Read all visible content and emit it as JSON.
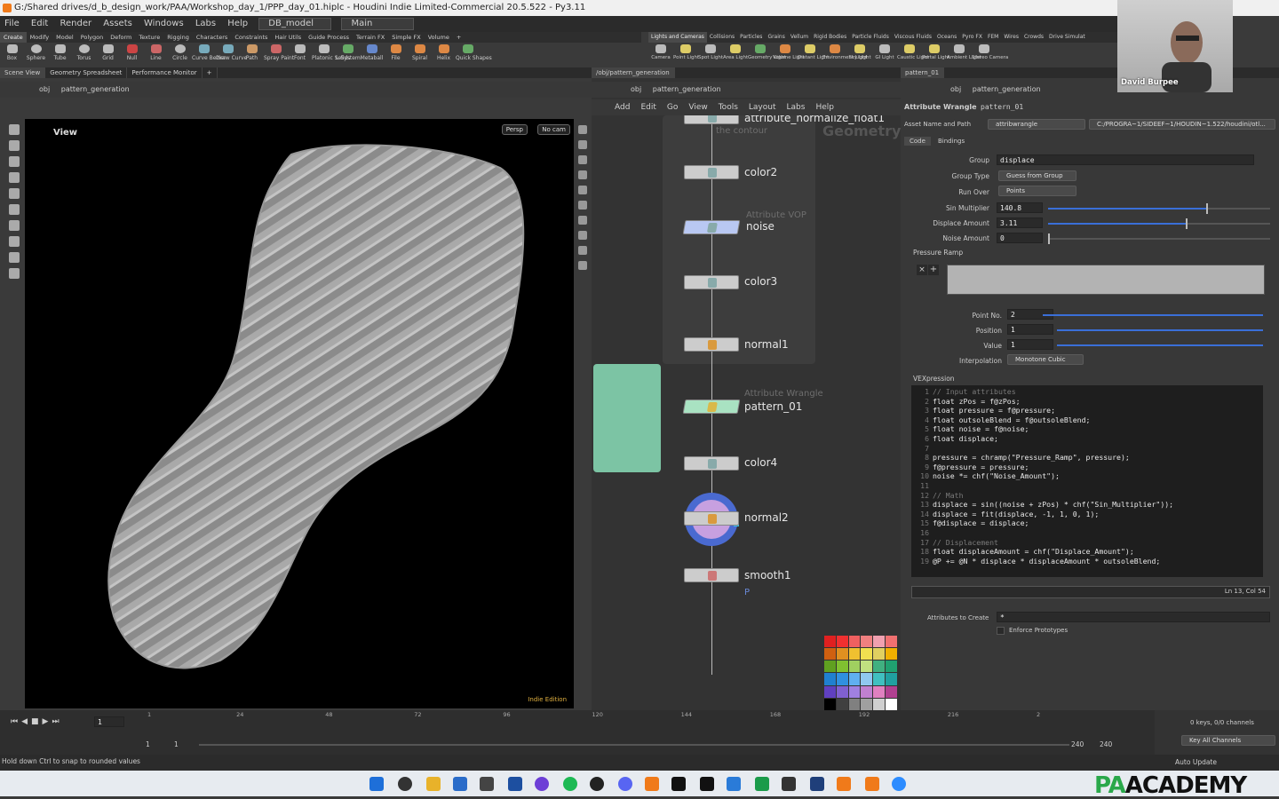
{
  "window": {
    "title": "G:/Shared drives/d_b_design_work/PAA/Workshop_day_1/PPP_day_01.hiplc - Houdini Indie Limited-Commercial 20.5.522 - Py3.11"
  },
  "menu": {
    "items": [
      "File",
      "Edit",
      "Render",
      "Assets",
      "Windows",
      "Labs",
      "Help"
    ],
    "desktop": "DB_model",
    "pane": "Main"
  },
  "shelf_tabs_left": [
    "Create",
    "Modify",
    "Model",
    "Polygon",
    "Deform",
    "Texture",
    "Rigging",
    "Characters",
    "Constraints",
    "Hair Utils",
    "Guide Process",
    "Terrain FX",
    "Simple FX",
    "Volume",
    "+"
  ],
  "shelf_tools_left": [
    "Box",
    "Sphere",
    "Tube",
    "Torus",
    "Grid",
    "Null",
    "Line",
    "Circle",
    "Curve Bezier",
    "Draw Curve",
    "Path",
    "Spray Paint",
    "Font",
    "Platonic Solids",
    "L-System",
    "Metaball",
    "File",
    "Spiral",
    "Helix",
    "Quick Shapes"
  ],
  "shelf_tabs_right": [
    "Lights and Cameras",
    "Collisions",
    "Particles",
    "Grains",
    "Vellum",
    "Rigid Bodies",
    "Particle Fluids",
    "Viscous Fluids",
    "Oceans",
    "Pyro FX",
    "FEM",
    "Wires",
    "Crowds",
    "Drive Simulat"
  ],
  "shelf_tools_right": [
    "Camera",
    "Point Light",
    "Spot Light",
    "Area Light",
    "Geometry Light",
    "Volume Light",
    "Distant Light",
    "Environment Light",
    "Sky Light",
    "GI Light",
    "Caustic Light",
    "Portal Light",
    "Ambient Light",
    "Stereo Camera"
  ],
  "viewer": {
    "tabs": [
      "Scene View",
      "Geometry Spreadsheet",
      "Performance Monitor",
      "+"
    ],
    "path_root": "obj",
    "path_node": "pattern_generation",
    "label": "View",
    "camera_mode": "Persp",
    "camera": "No cam",
    "edition": "Indie Edition"
  },
  "network": {
    "tab": "/obj/pattern_generation",
    "path_root": "obj",
    "path_node": "pattern_generation",
    "menu": [
      "Add",
      "Edit",
      "Go",
      "View",
      "Tools",
      "Layout",
      "Labs",
      "Help"
    ],
    "context_label": "Geometry",
    "nodes": [
      {
        "name": "attribute_normalize_float1",
        "type": "the contour"
      },
      {
        "name": "color2",
        "type": ""
      },
      {
        "name": "noise",
        "type": "Attribute VOP"
      },
      {
        "name": "color3",
        "type": ""
      },
      {
        "name": "normal1",
        "type": ""
      },
      {
        "name": "pattern_01",
        "type": "Attribute Wrangle"
      },
      {
        "name": "color4",
        "type": ""
      },
      {
        "name": "normal2",
        "type": ""
      },
      {
        "name": "smooth1",
        "type": ""
      }
    ],
    "smooth_flag": "P"
  },
  "params": {
    "tab": "pattern_01",
    "path_root": "obj",
    "path_node": "pattern_generation",
    "node_type": "Attribute Wrangle",
    "node_name": "pattern_01",
    "asset_label": "Asset Name and Path",
    "asset_name": "attribwrangle",
    "asset_path": "C:/PROGRA~1/SIDEEF~1/HOUDIN~1.522/houdini/otl...",
    "tabs": [
      "Code",
      "Bindings"
    ],
    "group_label": "Group",
    "group_value": "displace",
    "group_type_label": "Group Type",
    "group_type_value": "Guess from Group",
    "run_over_label": "Run Over",
    "run_over_value": "Points",
    "sin_label": "Sin Multiplier",
    "sin_value": "140.8",
    "sin_fraction": 0.71,
    "disp_label": "Displace Amount",
    "disp_value": "3.11",
    "disp_fraction": 0.62,
    "noise_label": "Noise Amount",
    "noise_value": "0",
    "noise_fraction": 0.0,
    "ramp_label": "Pressure Ramp",
    "point_no_label": "Point No.",
    "point_no_value": "2",
    "position_label": "Position",
    "position_value": "1",
    "value_label": "Value",
    "value_value": "1",
    "interp_label": "Interpolation",
    "interp_value": "Monotone Cubic",
    "vex_label": "VEXpression",
    "line_numbers": [
      "1",
      "2",
      "3",
      "4",
      "5",
      "6",
      "7",
      "8",
      "9",
      "10",
      "11",
      "12",
      "13",
      "14",
      "15",
      "16",
      "17",
      "18",
      "19"
    ],
    "code_lines": [
      "// Input attributes",
      "float zPos = f@zPos;",
      "float pressure = f@pressure;",
      "float outsoleBlend = f@outsoleBlend;",
      "float noise = f@noise;",
      "float displace;",
      "",
      "pressure = chramp(\"Pressure_Ramp\", pressure);",
      "f@pressure = pressure;",
      "noise *= chf(\"Noise_Amount\");",
      "",
      "// Math",
      "displace = sin((noise + zPos) * chf(\"Sin_Multiplier\"));",
      "displace = fit(displace, -1, 1, 0, 1);",
      "f@displace = displace;",
      "",
      "// Displacement",
      "float displaceAmount = chf(\"Displace_Amount\");",
      "@P += @N * displace * displaceAmount * outsoleBlend;"
    ],
    "cursor": "Ln 13, Col 54",
    "attrs_label": "Attributes to Create",
    "attrs_value": "*",
    "enforce_label": "Enforce Prototypes"
  },
  "timeline": {
    "ticks": [
      "1",
      "24",
      "48",
      "72",
      "96",
      "120",
      "144",
      "168",
      "192",
      "216",
      "2"
    ],
    "frame": "1",
    "start": "1",
    "start2": "1",
    "end": "240",
    "end2": "240",
    "keys": "0 keys, 0/0 channels",
    "key_all": "Key All Channels",
    "auto_update": "Auto Update"
  },
  "status": {
    "message": "Hold down Ctrl to snap to rounded values"
  },
  "webcam": {
    "name": "David Burpee"
  },
  "brand": {
    "pa": "PA",
    "rest": "ACADEMY"
  }
}
